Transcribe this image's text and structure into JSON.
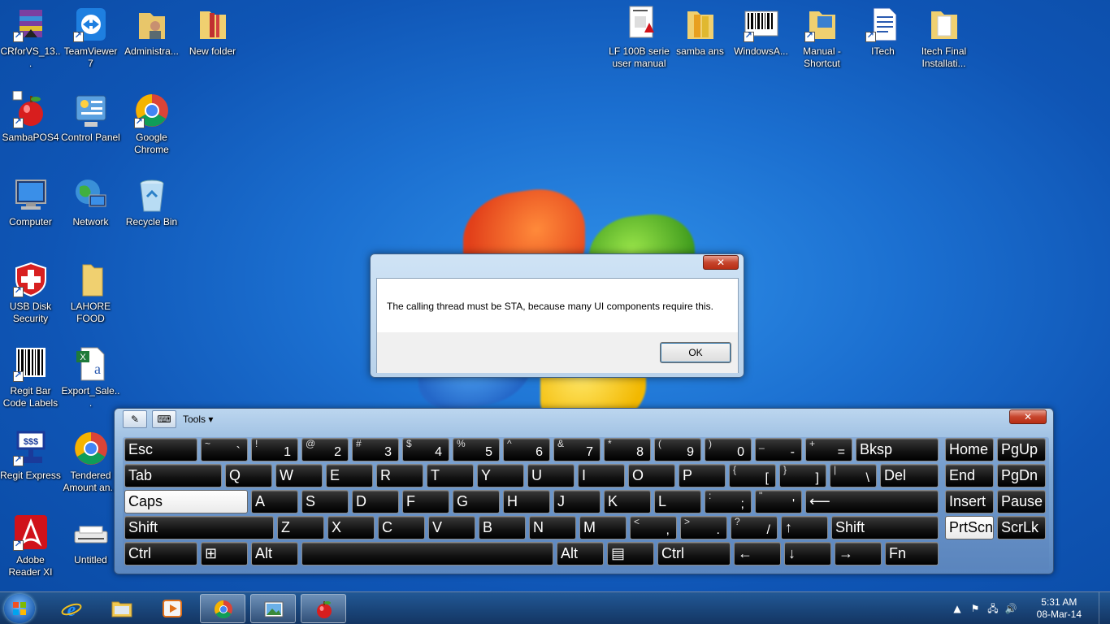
{
  "desktop": {
    "icons": [
      {
        "label": "CRforVS_13...",
        "icon": "winrar-archive-icon"
      },
      {
        "label": "TeamViewer 7",
        "icon": "teamviewer-icon"
      },
      {
        "label": "Administra...",
        "icon": "user-folder-icon"
      },
      {
        "label": "New folder",
        "icon": "folder-icon"
      },
      {
        "label": "SambaPOS4",
        "icon": "apple-icon"
      },
      {
        "label": "Control Panel",
        "icon": "control-panel-icon"
      },
      {
        "label": "Google Chrome",
        "icon": "chrome-icon"
      },
      {
        "label": "Computer",
        "icon": "computer-icon"
      },
      {
        "label": "Network",
        "icon": "network-icon"
      },
      {
        "label": "Recycle Bin",
        "icon": "recycle-bin-icon"
      },
      {
        "label": "USB Disk Security",
        "icon": "shield-icon"
      },
      {
        "label": "LAHORE FOOD",
        "icon": "folder-icon"
      },
      {
        "label": "Regit Bar Code Labels",
        "icon": "barcode-icon"
      },
      {
        "label": "Export_Sale...",
        "icon": "excel-file-icon"
      },
      {
        "label": "Regit Express",
        "icon": "cash-register-icon"
      },
      {
        "label": "Tendered Amount an...",
        "icon": "chrome-icon"
      },
      {
        "label": "Adobe Reader XI",
        "icon": "adobe-reader-icon"
      },
      {
        "label": "Untitled",
        "icon": "scanner-icon"
      },
      {
        "label": "LF 100B serie user manual",
        "icon": "pdf-file-icon"
      },
      {
        "label": "samba ans",
        "icon": "folder-icon"
      },
      {
        "label": "WindowsA...",
        "icon": "barcode-file-icon"
      },
      {
        "label": "Manual - Shortcut",
        "icon": "folder-icon"
      },
      {
        "label": "ITech",
        "icon": "document-icon"
      },
      {
        "label": "Itech Final Installati...",
        "icon": "folder-icon"
      }
    ]
  },
  "dialog": {
    "message": "The calling thread must be STA, because many UI components require this.",
    "ok_label": "OK",
    "close_glyph": "✕"
  },
  "osk": {
    "tools_label": "Tools",
    "close_glyph": "✕",
    "keys": {
      "esc": "Esc",
      "grave_s": "~",
      "grave_b": "`",
      "d1_s": "!",
      "d1_b": "1",
      "d2_s": "@",
      "d2_b": "2",
      "d3_s": "#",
      "d3_b": "3",
      "d4_s": "$",
      "d4_b": "4",
      "d5_s": "%",
      "d5_b": "5",
      "d6_s": "^",
      "d6_b": "6",
      "d7_s": "&",
      "d7_b": "7",
      "d8_s": "*",
      "d8_b": "8",
      "d9_s": "(",
      "d9_b": "9",
      "d0_s": ")",
      "d0_b": "0",
      "minus_s": "_",
      "minus_b": "-",
      "eq_s": "+",
      "eq_b": "=",
      "bksp": "Bksp",
      "home": "Home",
      "pgup": "PgUp",
      "tab": "Tab",
      "q": "Q",
      "w": "W",
      "e": "E",
      "r": "R",
      "t": "T",
      "y": "Y",
      "u": "U",
      "i": "I",
      "o": "O",
      "p": "P",
      "lbr_s": "{",
      "lbr_b": "[",
      "rbr_s": "}",
      "rbr_b": "]",
      "bsl_s": "|",
      "bsl_b": "\\",
      "del": "Del",
      "end": "End",
      "pgdn": "PgDn",
      "caps": "Caps",
      "a": "A",
      "s": "S",
      "d": "D",
      "f": "F",
      "g": "G",
      "h": "H",
      "j": "J",
      "k": "K",
      "l": "L",
      "semi_s": ":",
      "semi_b": ";",
      "quote_s": "\"",
      "quote_b": "'",
      "enter": "⟵",
      "insert": "Insert",
      "pause": "Pause",
      "shift": "Shift",
      "z": "Z",
      "x": "X",
      "c": "C",
      "v": "V",
      "b": "B",
      "n": "N",
      "m": "M",
      "comma_s": "<",
      "comma_b": ",",
      "period_s": ">",
      "period_b": ".",
      "slash_s": "?",
      "slash_b": "/",
      "up": "↑",
      "prtscn": "PrtScn",
      "scrlk": "ScrLk",
      "ctrl": "Ctrl",
      "alt": "Alt",
      "left": "←",
      "down": "↓",
      "right": "→",
      "fn": "Fn"
    }
  },
  "taskbar": {
    "clock_time": "5:31 AM",
    "clock_date": "08-Mar-14"
  },
  "colors": {
    "desktop_blue": "#1b6fd0",
    "close_red": "#c7452d",
    "key_black": "#111111"
  }
}
